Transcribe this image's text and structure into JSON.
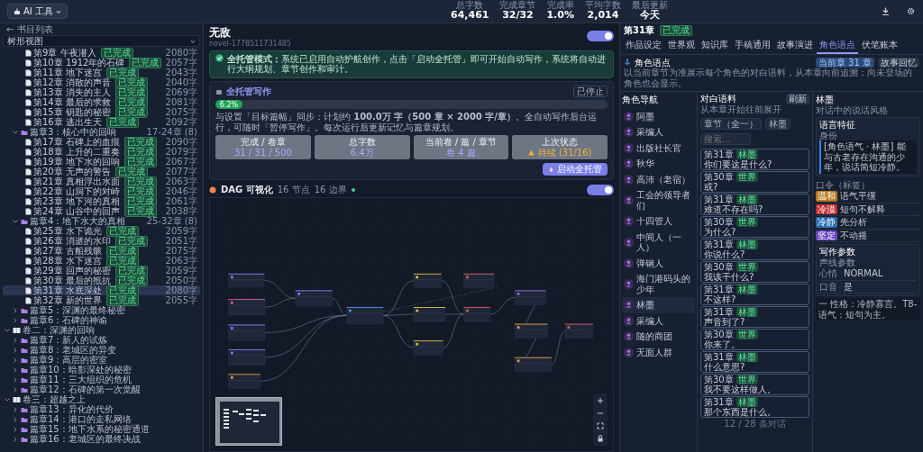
{
  "topbar": {
    "tool_button": "AI 工具",
    "stats": [
      {
        "label": "总字数",
        "value": "64,461"
      },
      {
        "label": "完成章节",
        "value": "32/32"
      },
      {
        "label": "完成率",
        "value": "1.0%"
      },
      {
        "label": "平均字数",
        "value": "2,014"
      },
      {
        "label": "最后更新",
        "value": "今天"
      }
    ]
  },
  "sidebar": {
    "back_link": "← 书目列表",
    "view_select": "树形视图",
    "tree": [
      {
        "children": [
          {
            "children": [
              {
                "kind": "chapter",
                "label": "第9章 午夜潜入",
                "status": "已完成",
                "words": "2080字",
                "selected": false
              },
              {
                "kind": "chapter",
                "label": "第10章 1912年的石碑",
                "status": "已完成",
                "words": "2057字",
                "selected": false
              },
              {
                "kind": "chapter",
                "label": "第11章 地下迷宫",
                "status": "已完成",
                "words": "2043字",
                "selected": false
              },
              {
                "kind": "chapter",
                "label": "第12章 消散的声音",
                "status": "已完成",
                "words": "2040字",
                "selected": false
              },
              {
                "kind": "chapter",
                "label": "第13章 消失的主人",
                "status": "已完成",
                "words": "2069字",
                "selected": false
              },
              {
                "kind": "chapter",
                "label": "第14章 最后的求救",
                "status": "已完成",
                "words": "2081字",
                "selected": false
              },
              {
                "kind": "chapter",
                "label": "第15章 钥匙的秘密",
                "status": "已完成",
                "words": "2075字",
                "selected": false
              },
              {
                "kind": "chapter",
                "label": "第16章 逃出生天",
                "status": "已完成",
                "words": "2092字",
                "selected": false
              }
            ]
          },
          {
            "kind": "arc",
            "label": "篇章3：核心中的回响",
            "range": "17-24章 (8)",
            "expanded": true,
            "children": [
              {
                "kind": "chapter",
                "label": "第17章 石碑上的血痕",
                "status": "已完成",
                "words": "2090字",
                "selected": false
              },
              {
                "kind": "chapter",
                "label": "第18章 上升的二重奏",
                "status": "已完成",
                "words": "2079字",
                "selected": false
              },
              {
                "kind": "chapter",
                "label": "第19章 地下水的回响",
                "status": "已完成",
                "words": "2067字",
                "selected": false
              },
              {
                "kind": "chapter",
                "label": "第20章 无声的警告",
                "status": "已完成",
                "words": "2077字",
                "selected": false
              },
              {
                "kind": "chapter",
                "label": "第21章 真相浮出水面",
                "status": "已完成",
                "words": "2063字",
                "selected": false
              },
              {
                "kind": "chapter",
                "label": "第22章 山洞下的对峙",
                "status": "已完成",
                "words": "2046字",
                "selected": false
              },
              {
                "kind": "chapter",
                "label": "第23章 地下河的真相",
                "status": "已完成",
                "words": "2061字",
                "selected": false
              },
              {
                "kind": "chapter",
                "label": "第24章 山谷中的回声",
                "status": "已完成",
                "words": "2038字",
                "selected": false
              }
            ]
          },
          {
            "kind": "arc",
            "label": "篇章4：地下水大的真相",
            "range": "25-32章 (8)",
            "expanded": true,
            "children": [
              {
                "kind": "chapter",
                "label": "第25章 水下诡光",
                "status": "已完成",
                "words": "2059字",
                "selected": false
              },
              {
                "kind": "chapter",
                "label": "第26章 消逝的水印",
                "status": "已完成",
                "words": "2051字",
                "selected": false
              },
              {
                "kind": "chapter",
                "label": "第27章 古船残骸",
                "status": "已完成",
                "words": "2075字",
                "selected": false
              },
              {
                "kind": "chapter",
                "label": "第28章 水下迷宫",
                "status": "已完成",
                "words": "2063字",
                "selected": false
              },
              {
                "kind": "chapter",
                "label": "第29章 回声的秘密",
                "status": "已完成",
                "words": "2059字",
                "selected": false
              },
              {
                "kind": "chapter",
                "label": "第30章 最后的抵抗",
                "status": "已完成",
                "words": "2050字",
                "selected": false
              },
              {
                "kind": "chapter",
                "label": "第31章 水底深处",
                "status": "已完成",
                "words": "2080字",
                "selected": true
              },
              {
                "kind": "chapter",
                "label": "第32章 新的世界",
                "status": "已完成",
                "words": "2055字",
                "selected": false
              }
            ]
          },
          {
            "kind": "arc",
            "label": "篇章5：深渊的最终秘密",
            "expanded": false
          },
          {
            "kind": "arc",
            "label": "篇章6：石碑的神谕",
            "expanded": false
          }
        ]
      },
      {
        "kind": "volume",
        "label": "卷二：深渊的回响",
        "expanded": true,
        "children": [
          {
            "kind": "arc",
            "label": "篇章7：新人的试炼",
            "expanded": false
          },
          {
            "kind": "arc",
            "label": "篇章8：老城区的异变",
            "expanded": false
          },
          {
            "kind": "arc",
            "label": "篇章9：高层的密室",
            "expanded": false
          },
          {
            "kind": "arc",
            "label": "篇章10：暗影深处的秘密",
            "expanded": false
          },
          {
            "kind": "arc",
            "label": "篇章11：三大组织的危机",
            "expanded": false
          },
          {
            "kind": "arc",
            "label": "篇章12：石碑的第一次觉醒",
            "expanded": false
          }
        ]
      },
      {
        "kind": "volume",
        "label": "卷三：超越之上",
        "expanded": true,
        "children": [
          {
            "kind": "arc",
            "label": "篇章13：异化的代价",
            "expanded": false
          },
          {
            "kind": "arc",
            "label": "篇章14：港口的走私网络",
            "expanded": false
          },
          {
            "kind": "arc",
            "label": "篇章15：地下水系的秘密通道",
            "expanded": false
          },
          {
            "kind": "arc",
            "label": "篇章16：老城区的最终决战",
            "expanded": false
          }
        ]
      }
    ]
  },
  "novel": {
    "title": "无敌",
    "id": "novel-1778511731485",
    "auto_toggle_on": true,
    "alert": "**全托管模式：**系统已启用自动护航创作，点击「启动全托管」即可开始自动写作，系统将自动进行大纲规划、章节创作和审计。",
    "autopilot": {
      "title": "全托管写作",
      "state": "已停止",
      "level": 0.062,
      "progress_label": "6.2%",
      "description": "与设置「目标篇幅」同步：计划约 **100.0万 字（500 章 × 2000 字/章）**。全自动写作后台运行，可随时「暂停写作」。每次运行后更新记忆与篇章规划。",
      "stats": [
        {
          "label": "完成 / 卷章",
          "value": "31 / 31 / 500",
          "warning": false
        },
        {
          "label": "总字数",
          "value": "6.4万",
          "warning": false
        },
        {
          "label": "当前卷 / 篇 / 章节",
          "value": "卷 4 篇",
          "warning": false
        },
        {
          "label": "上次状态",
          "value": "待续 (31/16)",
          "warning": true
        }
      ],
      "start_button": "启动全托管"
    }
  },
  "dag": {
    "title": "DAG 可视化",
    "nodes": "16 节点",
    "edges": "16 边界",
    "toggle_on": true
  },
  "panel": {
    "chapter": "第31章",
    "chapter_status": "已完成",
    "tabs": [
      {
        "label": "作品设定",
        "selected": false
      },
      {
        "label": "世界观",
        "selected": false
      },
      {
        "label": "知识库",
        "selected": false
      },
      {
        "label": "手稿通用",
        "selected": false
      },
      {
        "label": "故事演进",
        "selected": false
      },
      {
        "label": "角色语点",
        "selected": true
      },
      {
        "label": "伏笔账本",
        "selected": false
      }
    ],
    "section_title": "角色语点",
    "current_button": "当前章 31 章",
    "recall_button": "故事回忆",
    "section_desc": "以当前章节为准展示每个角色的对白语料，从本章向前追溯；尚未登场的角色也会显示。",
    "characters_title": "角色导航",
    "characters": [
      {
        "name": "阿墨",
        "selected": false
      },
      {
        "name": "采编人",
        "selected": false
      },
      {
        "name": "出版社长官",
        "selected": false
      },
      {
        "name": "秋华",
        "selected": false
      },
      {
        "name": "高沛（老宿）",
        "selected": false
      },
      {
        "name": "工会的领导者们",
        "selected": false
      },
      {
        "name": "十四管人",
        "selected": false
      },
      {
        "name": "中间人（一人）",
        "selected": false
      },
      {
        "name": "弹钢人",
        "selected": false
      },
      {
        "name": "海门港码头的少年",
        "selected": false
      },
      {
        "name": "林墨",
        "selected": true
      },
      {
        "name": "采编人",
        "selected": false
      },
      {
        "name": "随的商团",
        "selected": false
      },
      {
        "name": "无面人群",
        "selected": false
      }
    ],
    "dialogue": {
      "title": "对白语料",
      "subtitle": "从本章开始往前展开",
      "refresh": "刷新",
      "chapter_select": "章节（全一）",
      "speaker_select": "林墨",
      "search_placeholder": "搜索...",
      "lines": [
        {
          "chapter": "第31章",
          "tag": "林墨",
          "text": "你们要这是什么?"
        },
        {
          "chapter": "第30章",
          "tag": "世界",
          "text": "或?"
        },
        {
          "chapter": "第31章",
          "tag": "林墨",
          "text": "难道不存在吗?"
        },
        {
          "chapter": "第30章",
          "tag": "世界",
          "text": "为什么?"
        },
        {
          "chapter": "第31章",
          "tag": "林墨",
          "text": "你说什么?"
        },
        {
          "chapter": "第30章",
          "tag": "世界",
          "text": "我该干什么?"
        },
        {
          "chapter": "第31章",
          "tag": "林墨",
          "text": "不这样?"
        },
        {
          "chapter": "第31章",
          "tag": "林墨",
          "text": "声音到了?"
        },
        {
          "chapter": "第30章",
          "tag": "世界",
          "text": "你来了。"
        },
        {
          "chapter": "第31章",
          "tag": "林墨",
          "text": "什么意思?"
        },
        {
          "chapter": "第30章",
          "tag": "世界",
          "text": "我不要这样做人。"
        },
        {
          "chapter": "第31章",
          "tag": "林墨",
          "text": "那个东西是什么。"
        }
      ],
      "footer": "12 / 28 条对话"
    },
    "detail": {
      "name": "林墨",
      "subtitle": "对话中的说话风格",
      "voice_title": "语言特征",
      "voice_label": "身份",
      "voice_text": "[角色语气 · 林墨] 能与古老存在沟通的少年，说话简短冷静。",
      "tags_title": "口令（标签）",
      "tags": [
        {
          "label": "温和",
          "color": "#b7791f",
          "text": "语气平缓"
        },
        {
          "label": "冷漠",
          "color": "#c53030",
          "text": "短句不解释"
        },
        {
          "label": "冷静",
          "color": "#2b6cb0",
          "text": "先分析"
        },
        {
          "label": "坚定",
          "color": "#6b46c1",
          "text": "不动摇"
        }
      ],
      "params_title": "写作参数",
      "params_subtitle": "声线参数",
      "params": [
        {
          "key": "心情",
          "value": "NORMAL"
        },
        {
          "key": "口音",
          "value": "是"
        }
      ],
      "rules": "一 性格：冷静寡言。T8-语气：短句为主。"
    }
  }
}
